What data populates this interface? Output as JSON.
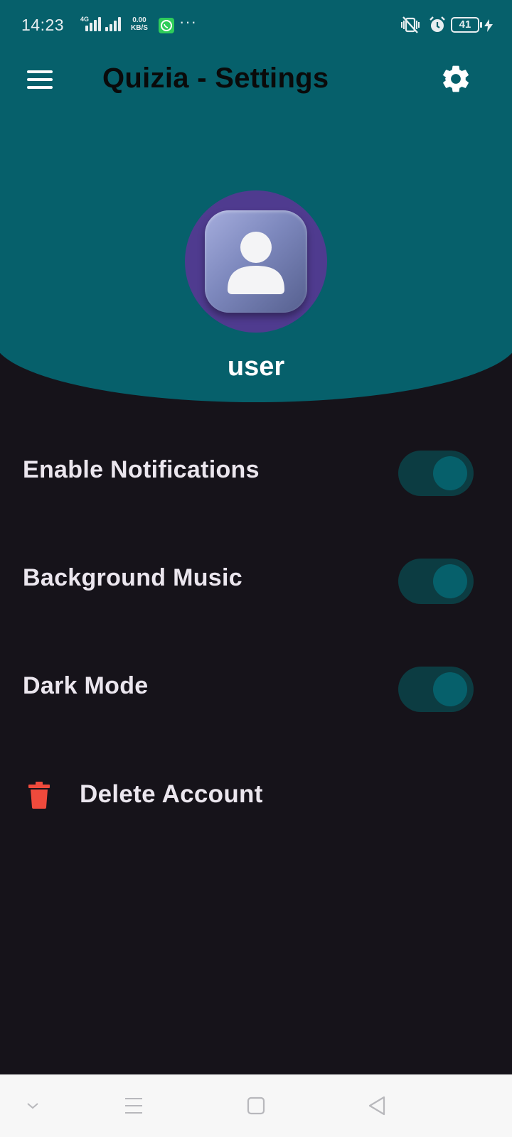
{
  "status_bar": {
    "time": "14:23",
    "network": "4G",
    "speed_value": "0.00",
    "speed_unit": "KB/S",
    "more": "···",
    "battery": "41"
  },
  "app_bar": {
    "title": "Quizia - Settings"
  },
  "profile": {
    "username": "user"
  },
  "settings": [
    {
      "label": "Enable Notifications",
      "enabled": true
    },
    {
      "label": "Background Music",
      "enabled": true
    },
    {
      "label": "Dark Mode",
      "enabled": true
    }
  ],
  "delete_account": {
    "label": "Delete Account"
  },
  "colors": {
    "header": "#06606b",
    "background": "#16131a",
    "toggle_track": "#0c3c42",
    "toggle_knob": "#06606b",
    "avatar_ring": "#4f3b8f",
    "danger": "#ef4a3c"
  }
}
